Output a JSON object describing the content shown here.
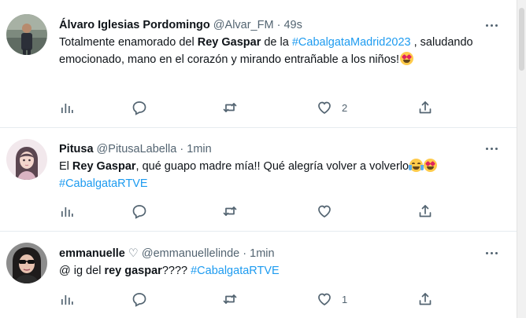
{
  "tweets": [
    {
      "name": "Álvaro Iglesias Pordomingo",
      "handle": "@Alvar_FM",
      "time": "49s",
      "text_parts": {
        "a": "Totalmente enamorado del ",
        "b": "Rey Gaspar",
        "c": " de la ",
        "tag": "#CabalgataMadrid2023",
        "d": " , saludando emocionado, mano en el corazón y mirando entrañable a los niños!"
      },
      "emoji": "smiling-face-with-heart-eyes",
      "like_count": "2"
    },
    {
      "name": "Pitusa",
      "handle": "@PitusaLabella",
      "time": "1min",
      "text_parts": {
        "a": "El ",
        "b": "Rey Gaspar",
        "c": ", qué guapo madre mía!! Qué alegría volver a volverlo",
        "tag": "#CabalgataRTVE"
      },
      "emoji": [
        "face-with-tears-of-joy",
        "smiling-face-with-heart-eyes"
      ]
    },
    {
      "name": "emmanuelle",
      "name_symbol": "♡",
      "handle": "@emmanuellelinde",
      "time": "1min",
      "text_parts": {
        "a": "@ ig del ",
        "b": "rey gaspar",
        "c": "???? ",
        "tag": "#CabalgataRTVE"
      },
      "like_count": "1"
    }
  ],
  "separator": "·",
  "colors": {
    "link": "#1d9bf0",
    "muted": "#536471",
    "text": "#0f1419",
    "divider": "#e6ecf0"
  },
  "icons": [
    "analytics-icon",
    "reply-icon",
    "retweet-icon",
    "like-icon",
    "share-icon",
    "more-icon"
  ]
}
